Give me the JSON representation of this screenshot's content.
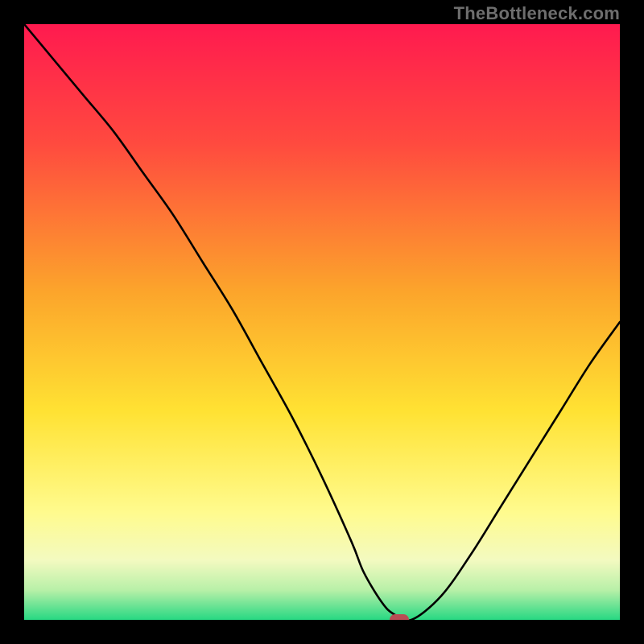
{
  "attribution": "TheBottleneck.com",
  "chart_data": {
    "type": "line",
    "title": "",
    "xlabel": "",
    "ylabel": "",
    "xlim": [
      0,
      100
    ],
    "ylim": [
      0,
      100
    ],
    "grid": false,
    "legend": null,
    "gradient_stops": [
      {
        "y_pct": 0,
        "color": "#ff1a4f"
      },
      {
        "y_pct": 20,
        "color": "#ff4a3f"
      },
      {
        "y_pct": 45,
        "color": "#fca52b"
      },
      {
        "y_pct": 65,
        "color": "#ffe233"
      },
      {
        "y_pct": 82,
        "color": "#fffb8e"
      },
      {
        "y_pct": 90,
        "color": "#f3fac0"
      },
      {
        "y_pct": 95,
        "color": "#b8f0a8"
      },
      {
        "y_pct": 100,
        "color": "#27d883"
      }
    ],
    "series": [
      {
        "name": "bottleneck-curve",
        "color": "#000000",
        "x": [
          0,
          5,
          10,
          15,
          20,
          25,
          30,
          35,
          40,
          45,
          50,
          55,
          57,
          60,
          62,
          65,
          70,
          75,
          80,
          85,
          90,
          95,
          100
        ],
        "values": [
          100,
          94,
          88,
          82,
          75,
          68,
          60,
          52,
          43,
          34,
          24,
          13,
          8,
          3,
          1,
          0,
          4,
          11,
          19,
          27,
          35,
          43,
          50
        ]
      }
    ],
    "marker": {
      "x": 63,
      "y": 0,
      "color": "#b94d54"
    }
  }
}
